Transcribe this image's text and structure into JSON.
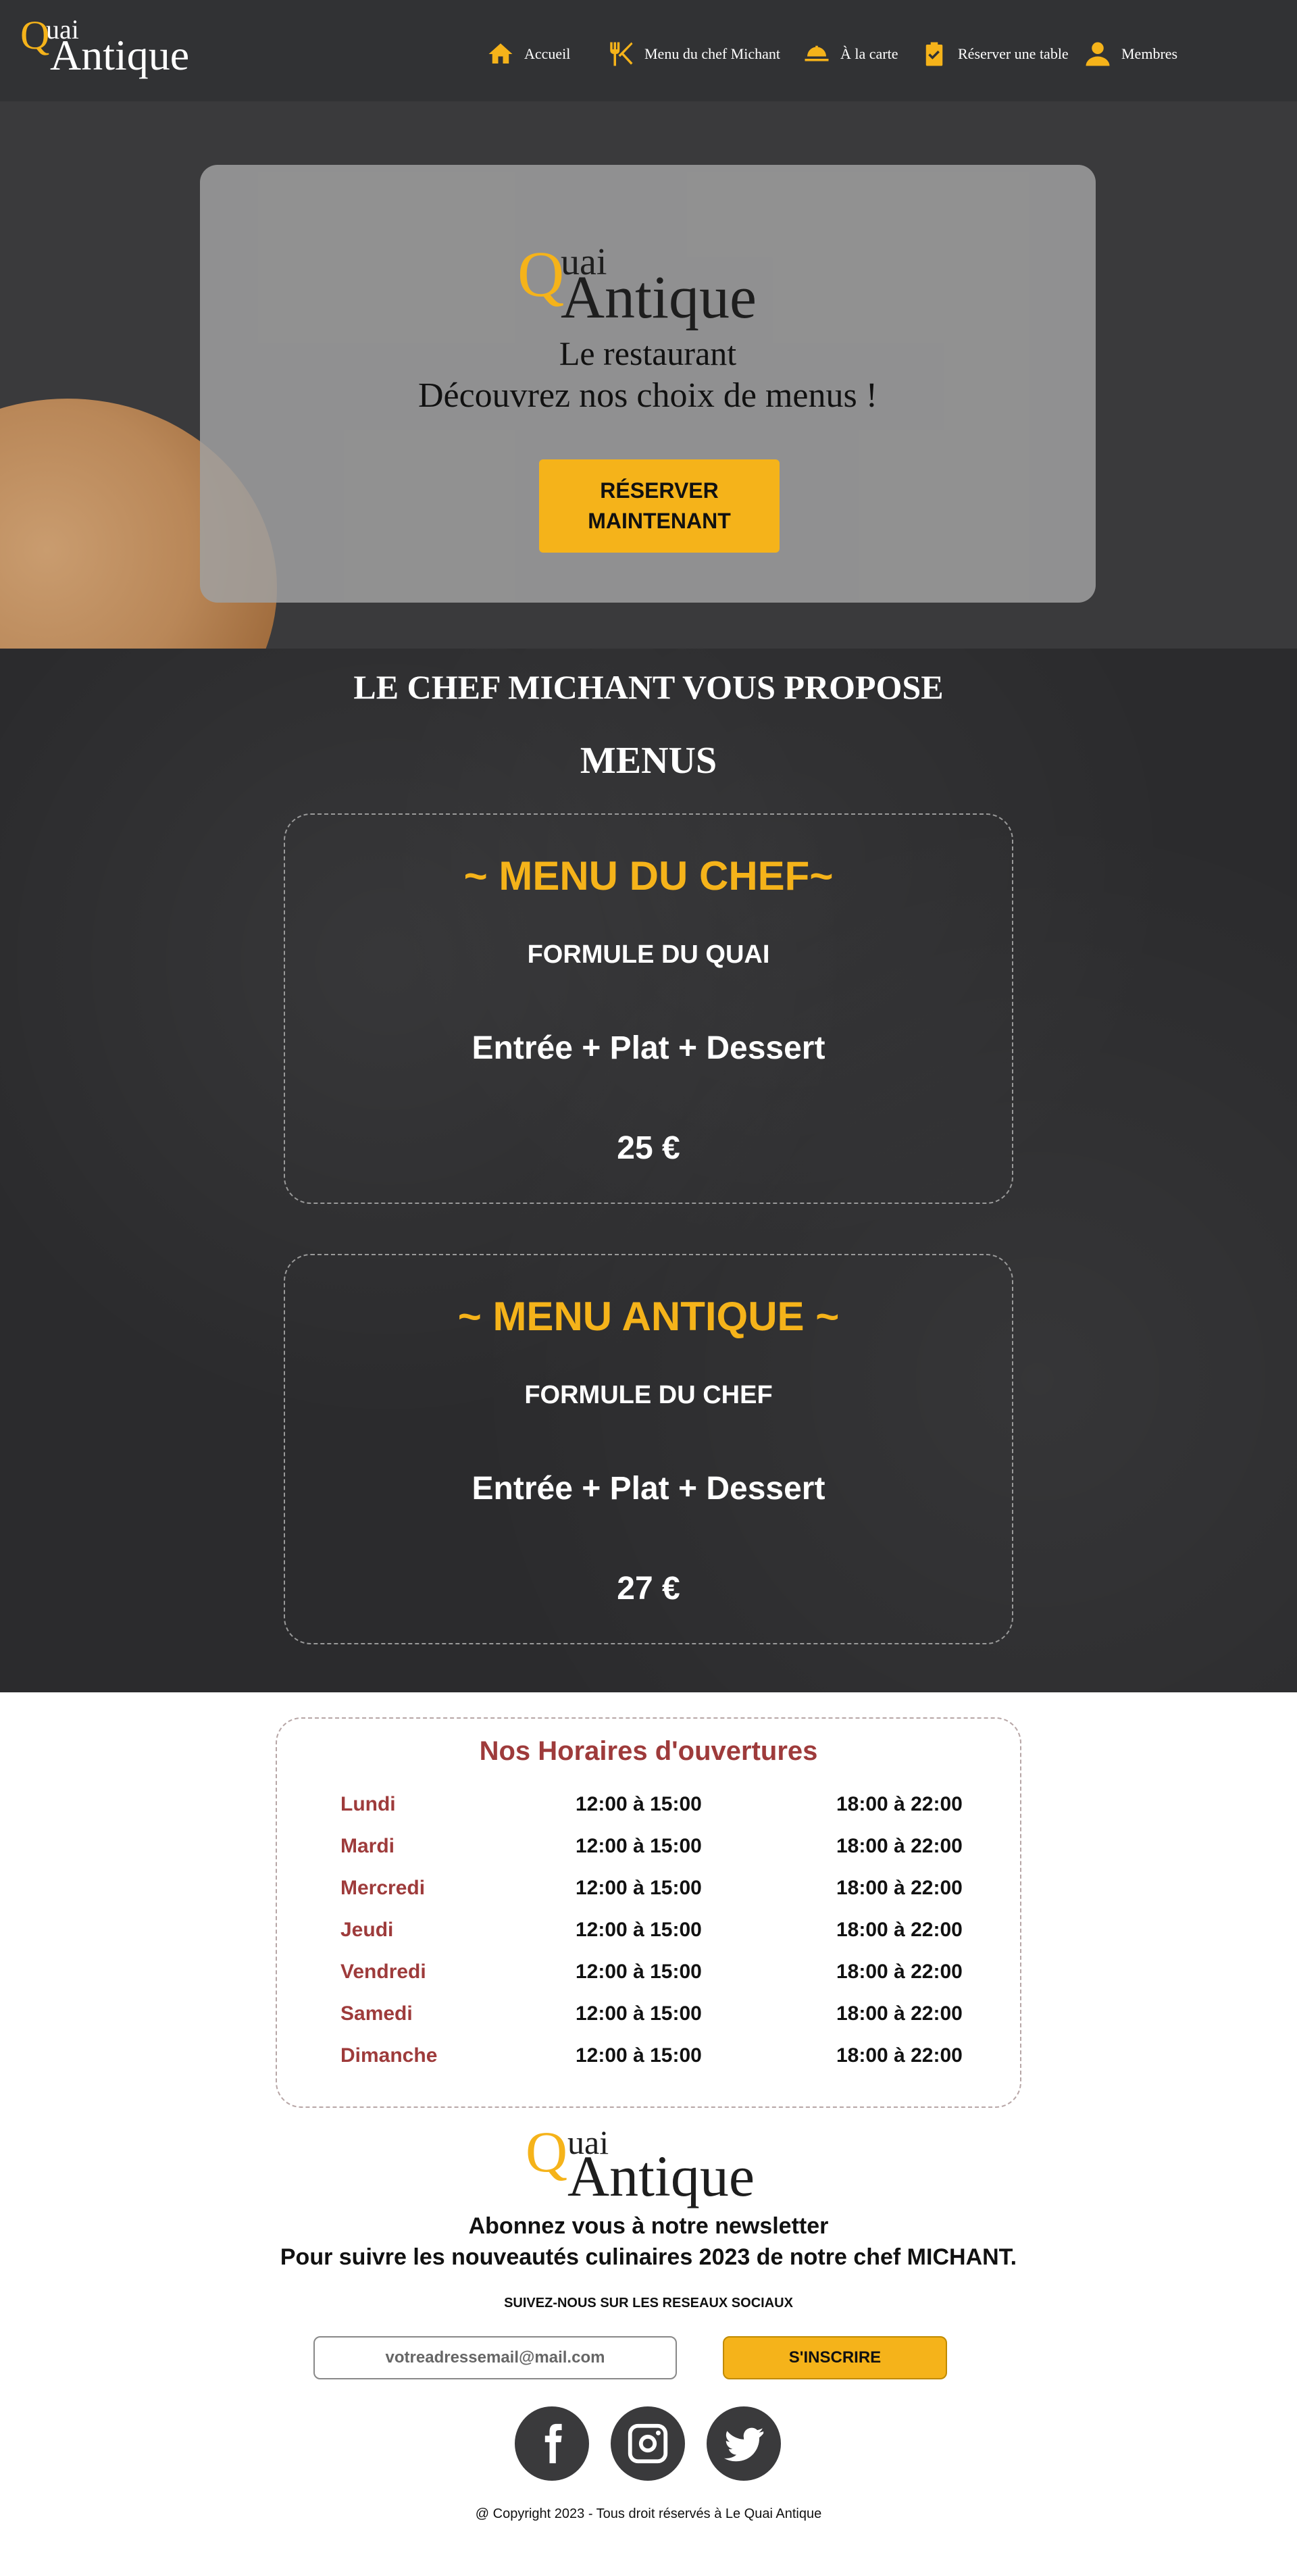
{
  "brand": {
    "q": "Q",
    "uai": "uai",
    "antique": "Antique"
  },
  "nav": {
    "items": [
      {
        "label": "Accueil",
        "icon": "home-icon"
      },
      {
        "label": "Menu du chef Michant",
        "icon": "utensils-icon"
      },
      {
        "label": "À la carte",
        "icon": "cloche-icon"
      },
      {
        "label": "Réserver une table",
        "icon": "clipboard-check-icon"
      },
      {
        "label": "Membres",
        "icon": "user-icon"
      }
    ]
  },
  "hero": {
    "line1": "Le restaurant",
    "line2": "Découvrez nos choix de menus !",
    "reserve_label": "RÉSERVER MAINTENANT"
  },
  "menus": {
    "title1": "LE CHEF MICHANT VOUS PROPOSE",
    "title2": "MENUS",
    "cards": [
      {
        "title": "~ MENU DU CHEF~",
        "subtitle": "FORMULE DU QUAI",
        "desc": "Entrée + Plat + Dessert",
        "price": "25 €"
      },
      {
        "title": "~ MENU ANTIQUE ~",
        "subtitle": "FORMULE DU CHEF",
        "desc": "Entrée + Plat + Dessert",
        "price": "27 €"
      }
    ]
  },
  "hours": {
    "title": "Nos Horaires d'ouvertures",
    "rows": [
      {
        "day": "Lundi",
        "am": "12:00 à 15:00",
        "pm": "18:00 à 22:00"
      },
      {
        "day": "Mardi",
        "am": "12:00 à 15:00",
        "pm": "18:00 à 22:00"
      },
      {
        "day": "Mercredi",
        "am": "12:00 à 15:00",
        "pm": "18:00 à 22:00"
      },
      {
        "day": "Jeudi",
        "am": "12:00 à 15:00",
        "pm": "18:00 à 22:00"
      },
      {
        "day": "Vendredi",
        "am": "12:00 à 15:00",
        "pm": "18:00 à 22:00"
      },
      {
        "day": "Samedi",
        "am": "12:00 à 15:00",
        "pm": "18:00 à 22:00"
      },
      {
        "day": "Dimanche",
        "am": "12:00 à 15:00",
        "pm": "18:00 à 22:00"
      }
    ]
  },
  "footer": {
    "newsletter_line1": "Abonnez vous à notre newsletter",
    "newsletter_line2": "Pour suivre les nouveautés culinaires 2023 de notre chef MICHANT.",
    "social_caption": "SUIVEZ-NOUS SUR LES RESEAUX SOCIAUX",
    "email_placeholder": "votreadressemail@mail.com",
    "subscribe_label": "S'INSCRIRE",
    "copyright": "@ Copyright 2023 - Tous droit réservés à  Le Quai Antique"
  },
  "colors": {
    "accent": "#f5b31a",
    "nav_bg": "#313234",
    "hours_red": "#9e3b3b",
    "board_bg": "#2b2b2d"
  }
}
